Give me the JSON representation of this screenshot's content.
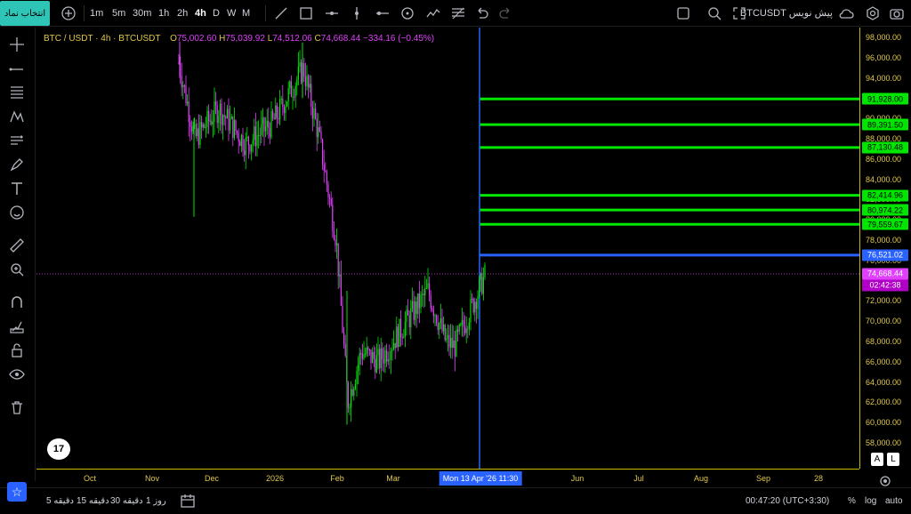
{
  "toolbar": {
    "symbol_button": "انتخاب نماد",
    "intervals": [
      "1m",
      "5m",
      "30m",
      "1h",
      "2h",
      "4h",
      "D",
      "W",
      "M"
    ],
    "active_interval": "4h",
    "title": "BTCUSDT پیش نویس"
  },
  "legend": {
    "symbol": "BTC / USDT · 4h · BTCUSDT",
    "open_label": "O",
    "open": "75,002.60",
    "high_label": "H",
    "high": "75,039.92",
    "low_label": "L",
    "low": "74,512.06",
    "close_label": "C",
    "close": "74,668.44",
    "change": "−334.16 (−0.45%)"
  },
  "price_axis": {
    "ticks": [
      "98,000.00",
      "96,000.00",
      "94,000.00",
      "92,000.00",
      "90,000.00",
      "88,000.00",
      "86,000.00",
      "84,000.00",
      "82,000.00",
      "80,000.00",
      "78,000.00",
      "76,000.00",
      "74,000.00",
      "72,000.00",
      "70,000.00",
      "68,000.00",
      "66,000.00",
      "64,000.00",
      "62,000.00",
      "60,000.00",
      "58,000.00"
    ],
    "level_labels": [
      "91,928.00",
      "89,391.50",
      "87,130.48",
      "82,414.96",
      "80,974.22",
      "79,559.67"
    ],
    "blue_label": "76,521.02",
    "current_price": "74,668.44",
    "countdown": "02:42:38",
    "btn_a": "A",
    "btn_l": "L"
  },
  "time_axis": {
    "ticks": [
      "Oct",
      "Nov",
      "Dec",
      "2026",
      "Feb",
      "Mar",
      "Jun",
      "Jul",
      "Aug",
      "Sep",
      "28"
    ],
    "crosshair_date": "Mon 13 Apr '26",
    "crosshair_time": "11:30"
  },
  "bottombar": {
    "ranges": [
      "5 دقیقه",
      "15 دقیقه",
      "30 دقیقه",
      "1 روز"
    ],
    "clock": "00:47:20 (UTC+3:30)",
    "percent": "%",
    "log": "log",
    "auto": "auto"
  },
  "chart_data": {
    "type": "candlestick",
    "symbol": "BTCUSDT",
    "interval": "4h",
    "ylim": [
      57000,
      99000
    ],
    "horizontal_levels": [
      91928.0,
      89391.5,
      87130.48,
      82414.96,
      80974.22,
      79559.67
    ],
    "blue_level": 76521.02,
    "current_price": 74668.44,
    "price_path": [
      {
        "t": "Nov",
        "price": 95500
      },
      {
        "t": "Nov-mid",
        "price": 88000
      },
      {
        "t": "Dec",
        "price": 91000
      },
      {
        "t": "Dec-mid",
        "price": 87500
      },
      {
        "t": "2026",
        "price": 89500
      },
      {
        "t": "Jan-mid",
        "price": 95000
      },
      {
        "t": "Jan-end",
        "price": 88000
      },
      {
        "t": "Feb",
        "price": 78000
      },
      {
        "t": "Feb-low",
        "price": 62000
      },
      {
        "t": "Feb-end",
        "price": 67000
      },
      {
        "t": "Mar",
        "price": 66000
      },
      {
        "t": "Mar-mid",
        "price": 73000
      },
      {
        "t": "Mar-end",
        "price": 68000
      },
      {
        "t": "Apr",
        "price": 67500
      },
      {
        "t": "Apr-13",
        "price": 74668
      }
    ],
    "colors": {
      "up": "#00e600",
      "down": "#e040fb",
      "levels": "#00e600",
      "blue": "#2962ff",
      "crosshair": "#2962ff"
    }
  }
}
